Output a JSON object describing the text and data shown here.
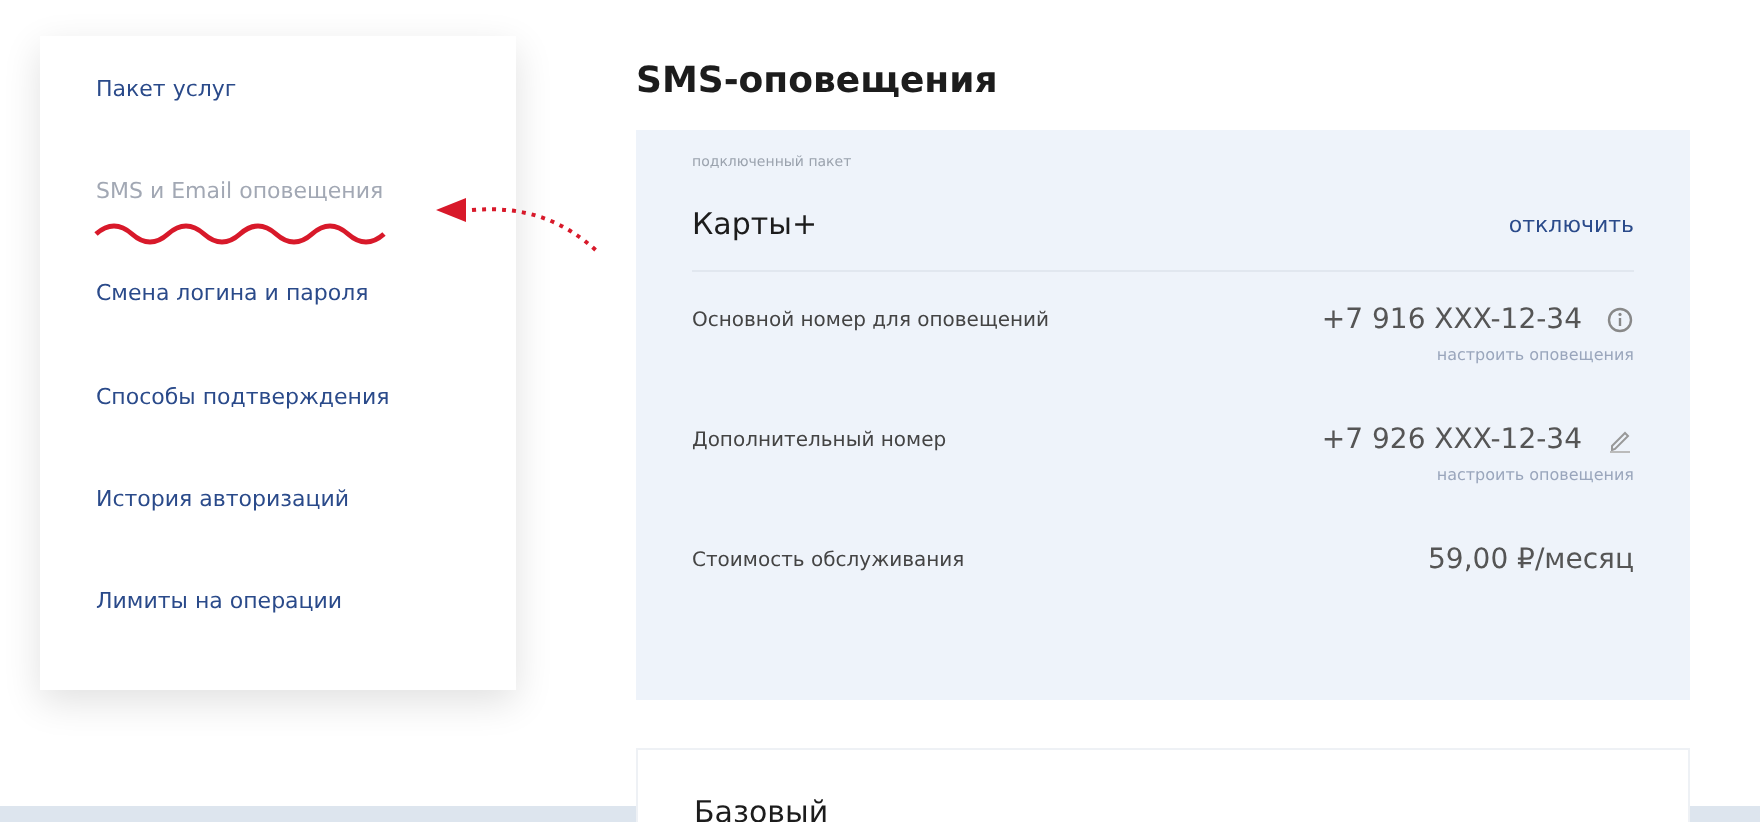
{
  "sidebar": {
    "items": [
      {
        "label": "Пакет услуг",
        "selected": false
      },
      {
        "label": "SMS и Email оповещения",
        "selected": true
      },
      {
        "label": "Смена логина и пароля",
        "selected": false
      },
      {
        "label": "Способы подтверждения",
        "selected": false
      },
      {
        "label": "История авторизаций",
        "selected": false
      },
      {
        "label": "Лимиты на операции",
        "selected": false
      }
    ]
  },
  "page_title": "SMS-оповещения",
  "packages": [
    {
      "caption": "подключенный пакет",
      "name": "Карты+",
      "action": "отключить",
      "rows": [
        {
          "label": "Основной номер для оповещений",
          "value": "+7 916 XXX-12-34",
          "kind": "info",
          "link": "настроить оповещения"
        },
        {
          "label": "Дополнительный номер",
          "value": "+7 926 XXX-12-34",
          "kind": "edit",
          "link": "настроить оповещения"
        },
        {
          "label": "Стоимость обслуживания",
          "value": "59,00 ₽/месяц",
          "kind": "plain"
        }
      ]
    },
    {
      "name": "Базовый"
    }
  ]
}
